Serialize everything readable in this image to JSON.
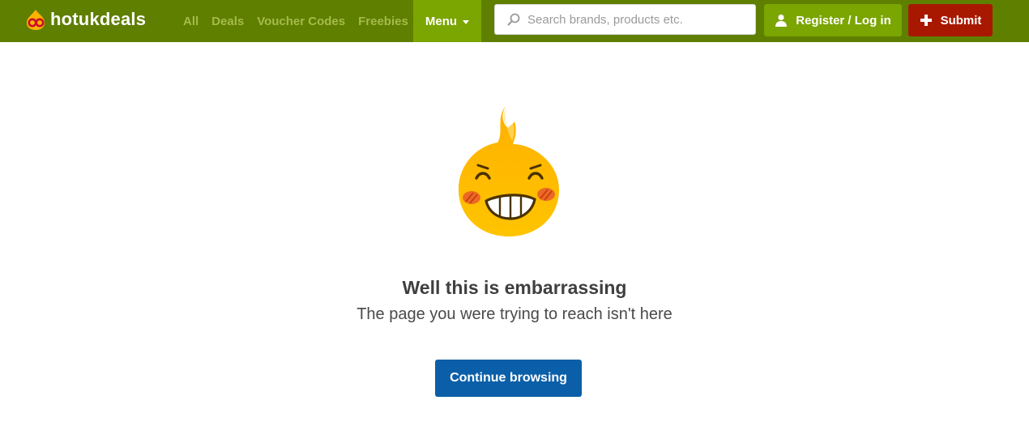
{
  "header": {
    "logo_text": "hotukdeals",
    "nav_links": [
      "All",
      "Deals",
      "Voucher Codes",
      "Freebies"
    ],
    "menu_label": "Menu",
    "search_placeholder": "Search brands, products etc.",
    "register_label": "Register / Log in",
    "submit_label": "Submit"
  },
  "main": {
    "heading": "Well this is embarrassing",
    "subheading": "The page you were trying to reach isn't here",
    "continue_label": "Continue browsing"
  },
  "colors": {
    "header_bg": "#5f7f00",
    "accent_green": "#7ba500",
    "nav_link": "#a4bb4a",
    "submit_red": "#a81800",
    "continue_blue": "#0b5fa8",
    "mascot_orange": "#ffb300"
  },
  "icons": [
    "hotukdeals-logo-icon",
    "search-icon",
    "user-icon",
    "plus-icon",
    "flame-mascot-icon"
  ]
}
